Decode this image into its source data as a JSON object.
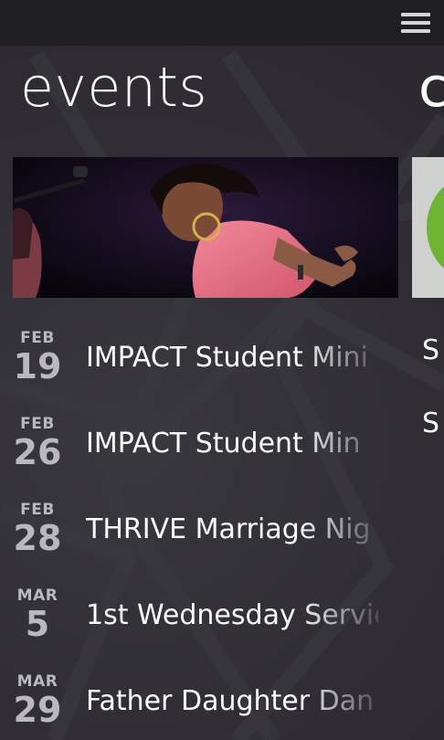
{
  "header": {
    "menu_icon": "hamburger-menu-icon"
  },
  "section": {
    "title": "events",
    "next_title_partial": "c"
  },
  "hero": {
    "image_description_icon": "event-hero-photo"
  },
  "events": [
    {
      "month": "FEB",
      "day": "19",
      "title": "IMPACT Student Mini"
    },
    {
      "month": "FEB",
      "day": "26",
      "title": "IMPACT Student Min"
    },
    {
      "month": "FEB",
      "day": "28",
      "title": "THRIVE Marriage Nig"
    },
    {
      "month": "MAR",
      "day": "5",
      "title": "1st Wednesday Servic"
    },
    {
      "month": "MAR",
      "day": "29",
      "title": "Father Daughter Dan"
    }
  ],
  "next_panel": {
    "items": [
      "S",
      "S"
    ]
  },
  "colors": {
    "background": "#2f2d33",
    "topbar": "#1f1e22",
    "date_text": "#b9b8bd",
    "accent_green": "#6fb334"
  }
}
